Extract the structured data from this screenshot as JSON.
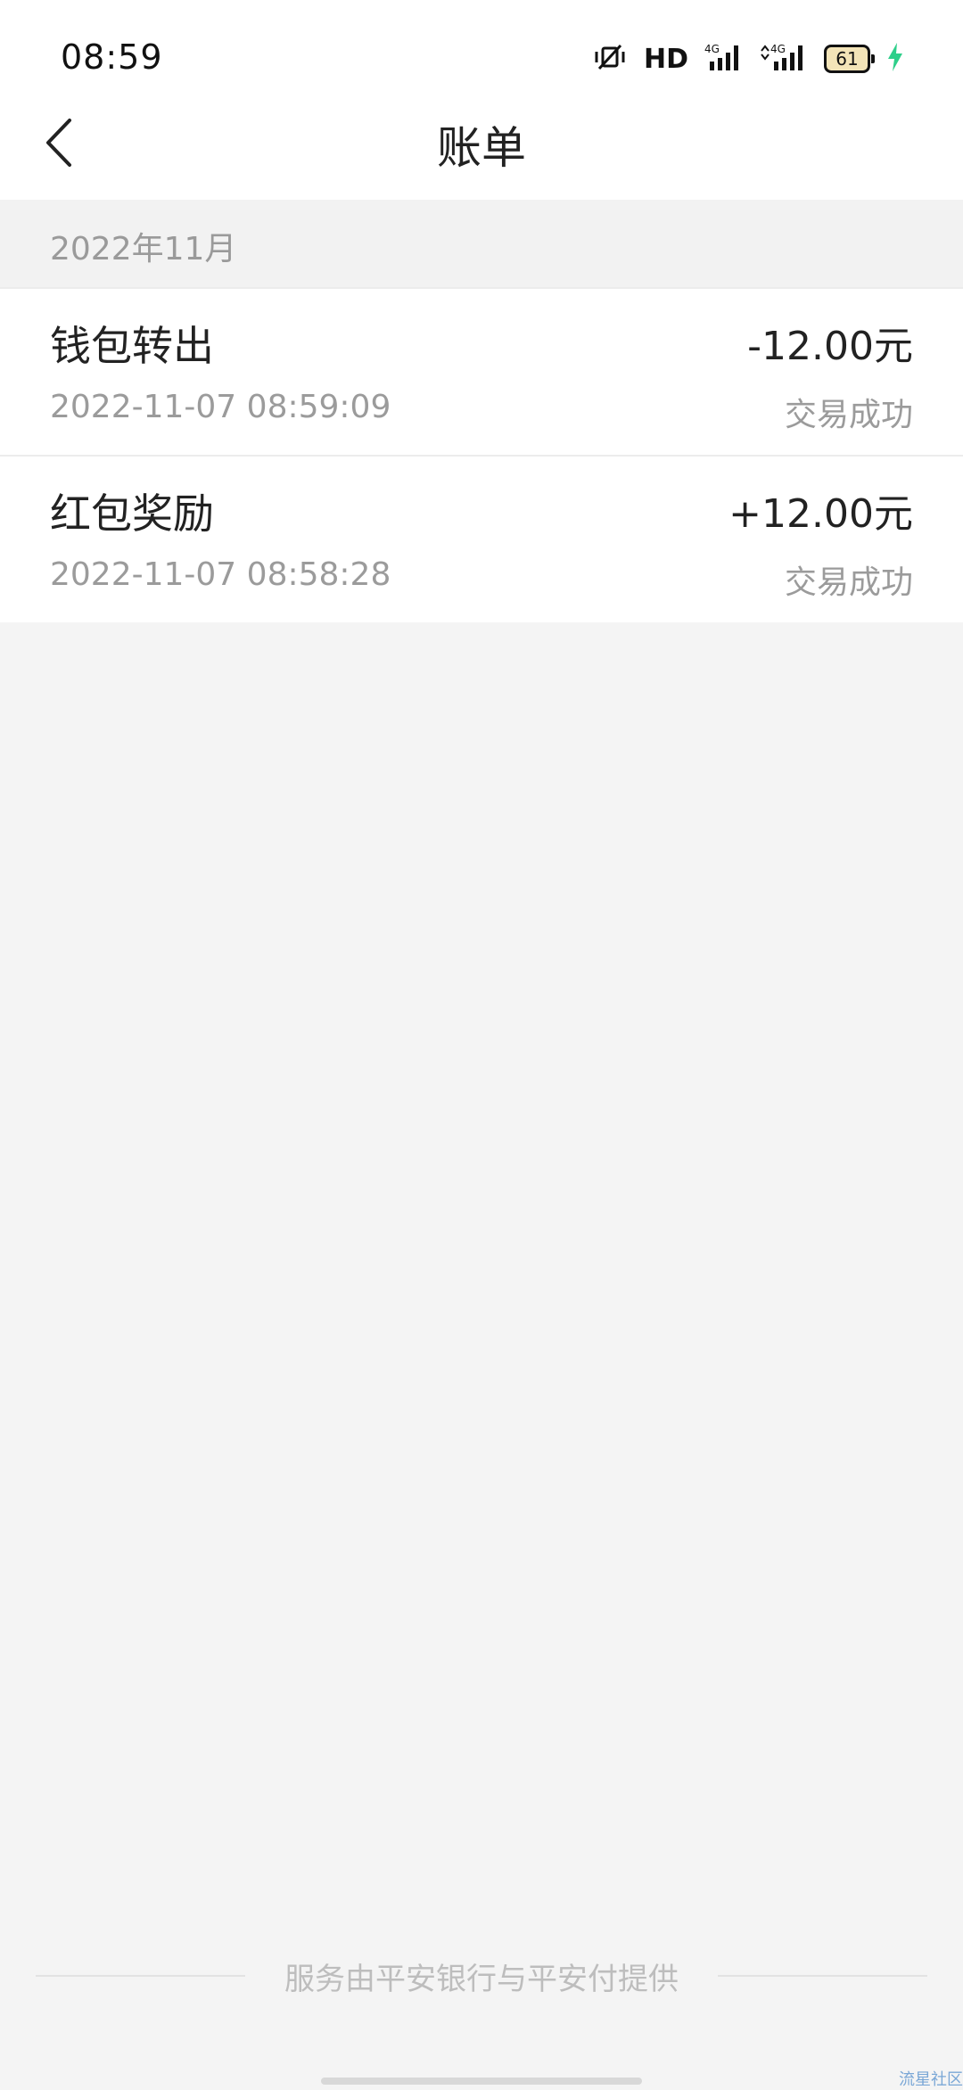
{
  "status_bar": {
    "time": "08:59",
    "network_label": "HD",
    "battery_level": "61",
    "icons": [
      "vibrate-icon",
      "hd-icon",
      "signal-4g-icon",
      "signal-4g-icon",
      "battery-icon",
      "charging-icon"
    ]
  },
  "header": {
    "title": "账单",
    "back_icon": "chevron-left-icon"
  },
  "month": {
    "label": "2022年11月"
  },
  "transactions": [
    {
      "title": "钱包转出",
      "amount": "-12.00元",
      "time": "2022-11-07 08:59:09",
      "status": "交易成功"
    },
    {
      "title": "红包奖励",
      "amount": "+12.00元",
      "time": "2022-11-07 08:58:28",
      "status": "交易成功"
    }
  ],
  "footer": {
    "text": "服务由平安银行与平安付提供"
  },
  "watermark": "流星社区",
  "colors": {
    "background": "#f4f4f4",
    "card": "#ffffff",
    "text_primary": "#222222",
    "text_secondary": "#9b9b9b",
    "charging": "#2ecf8a"
  }
}
